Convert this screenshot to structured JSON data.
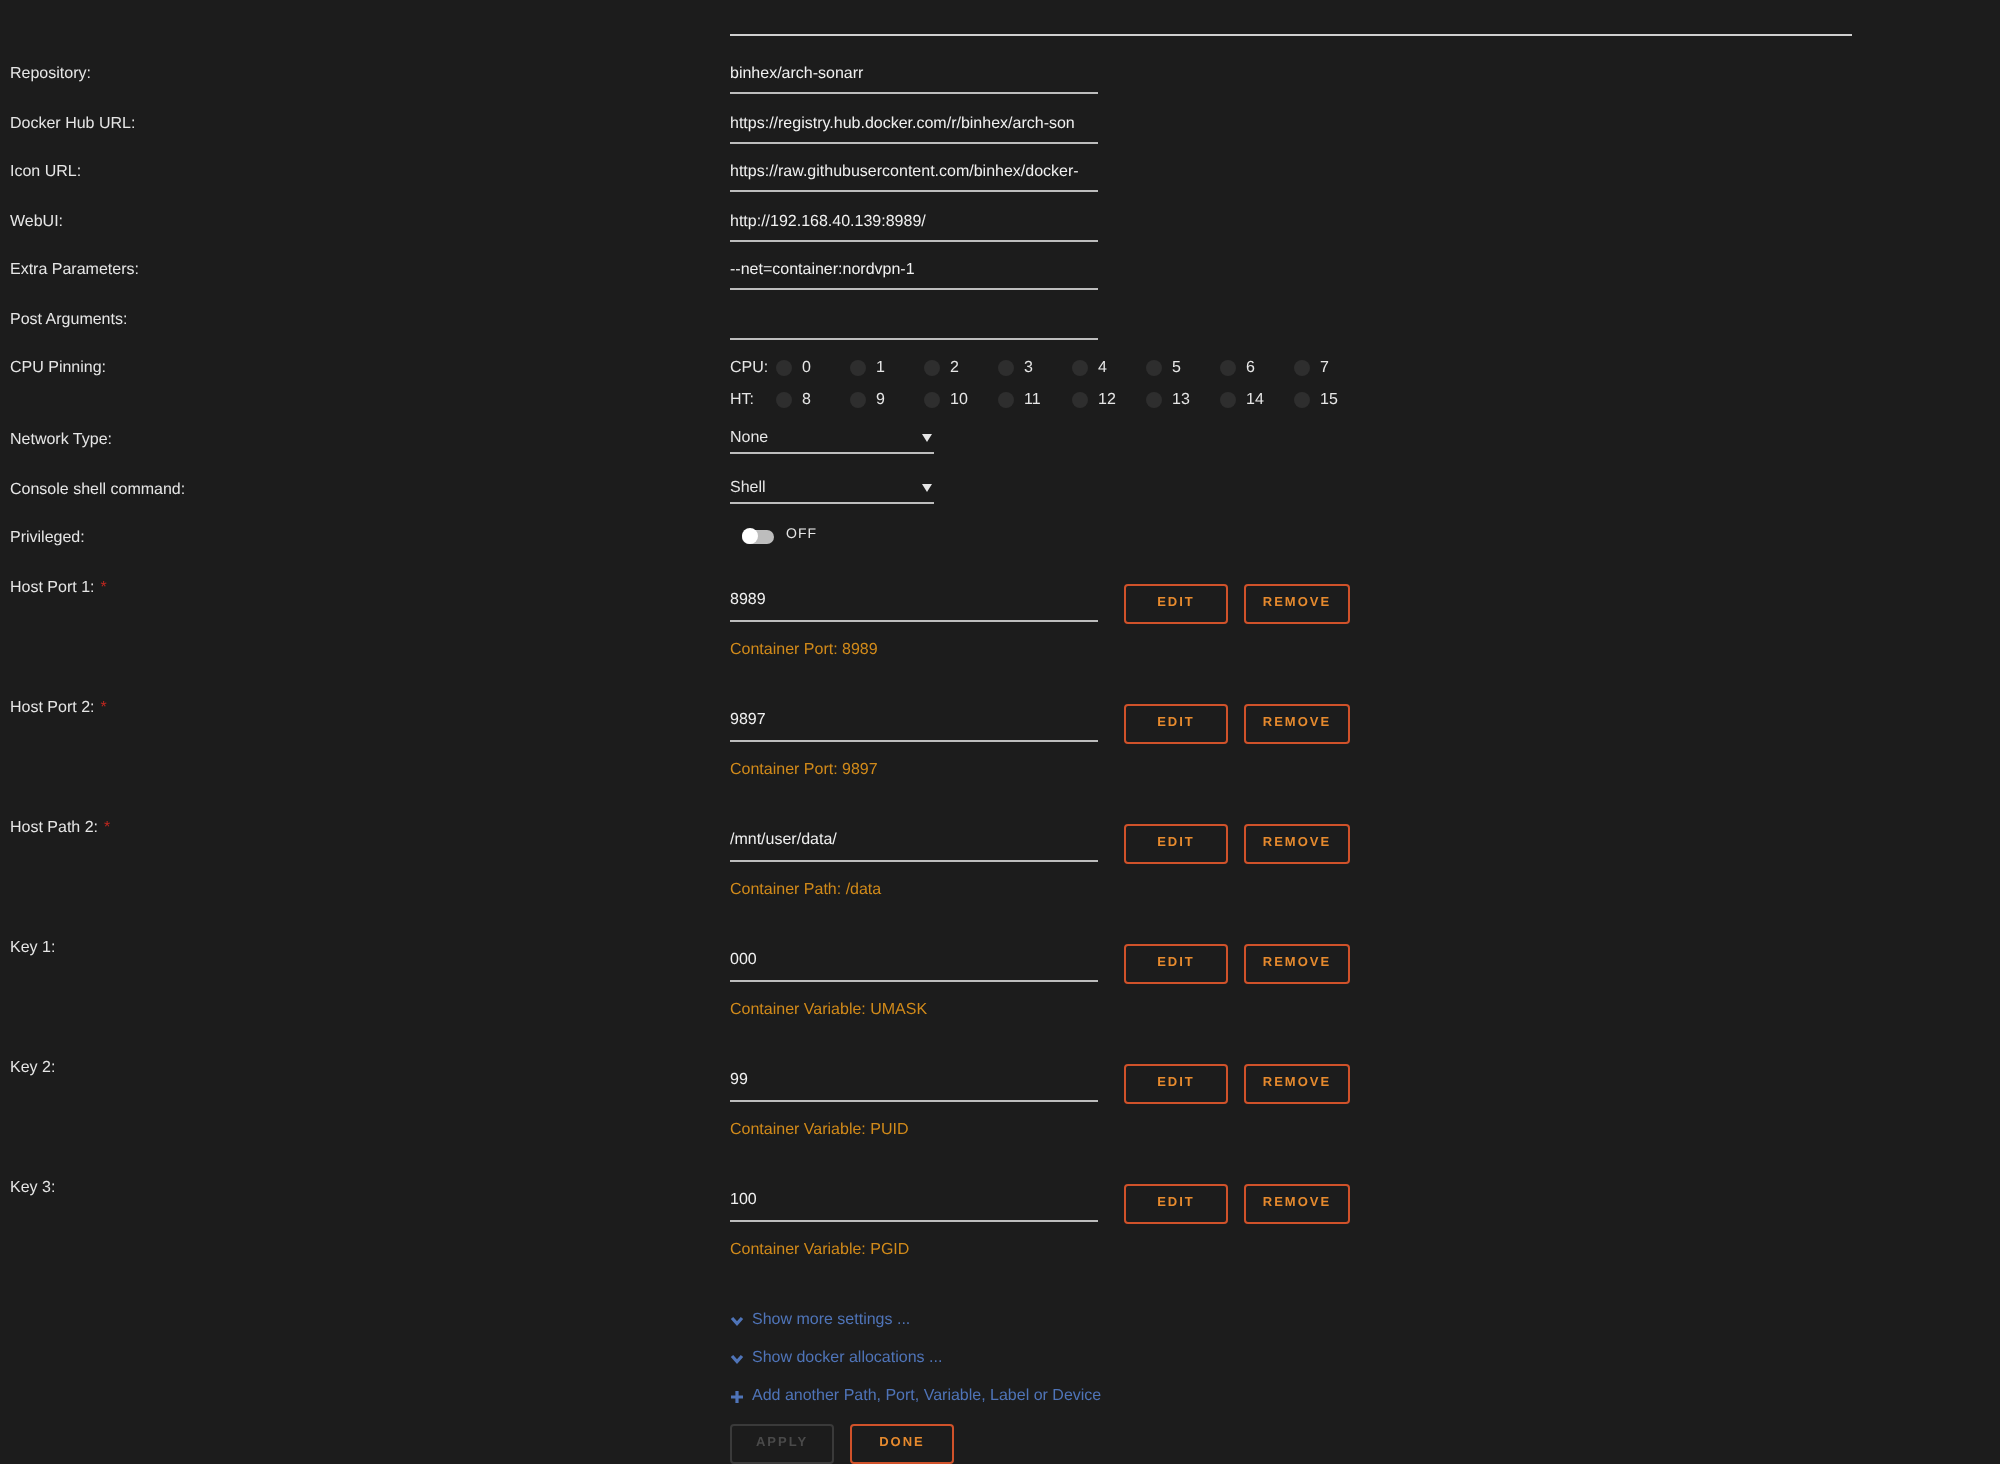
{
  "settings": [
    {
      "kind": "text",
      "label": "Repository:",
      "value": "binhex/arch-sonarr"
    },
    {
      "kind": "text",
      "label": "Docker Hub URL:",
      "value": "https://registry.hub.docker.com/r/binhex/arch-son"
    },
    {
      "kind": "text",
      "label": "Icon URL:",
      "value": "https://raw.githubusercontent.com/binhex/docker-"
    },
    {
      "kind": "text",
      "label": "WebUI:",
      "value": "http://192.168.40.139:8989/"
    },
    {
      "kind": "text",
      "label": "Extra Parameters:",
      "value": "--net=container:nordvpn-1"
    },
    {
      "kind": "text",
      "label": "Post Arguments:"
    },
    {
      "kind": "cpu",
      "label": "CPU Pinning:",
      "rows": [
        {
          "label": "CPU:",
          "cores": [
            {
              "label": "0",
              "checked": false
            },
            {
              "label": "1",
              "checked": false
            },
            {
              "label": "2",
              "checked": false
            },
            {
              "label": "3",
              "checked": false
            },
            {
              "label": "4",
              "checked": false
            },
            {
              "label": "5",
              "checked": false
            },
            {
              "label": "6",
              "checked": false
            },
            {
              "label": "7",
              "checked": false
            }
          ]
        },
        {
          "label": "HT:",
          "cores": [
            {
              "label": "8",
              "checked": false
            },
            {
              "label": "9",
              "checked": false
            },
            {
              "label": "10",
              "checked": false
            },
            {
              "label": "11",
              "checked": false
            },
            {
              "label": "12",
              "checked": false
            },
            {
              "label": "13",
              "checked": false
            },
            {
              "label": "14",
              "checked": false
            },
            {
              "label": "15",
              "checked": false
            }
          ]
        }
      ]
    },
    {
      "kind": "select",
      "label": "Network Type:",
      "value": "None"
    },
    {
      "kind": "select",
      "label": "Console shell command:",
      "value": "Shell"
    },
    {
      "kind": "toggle",
      "label": "Privileged:",
      "on": false,
      "state_text": "OFF"
    }
  ],
  "mappings": [
    {
      "label": "Host Port 1:",
      "required": true,
      "value": "8989",
      "description": "Container Port: 8989",
      "edit": "EDIT",
      "remove": "REMOVE"
    },
    {
      "label": "Host Port 2:",
      "required": true,
      "value": "9897",
      "description": "Container Port: 9897",
      "edit": "EDIT",
      "remove": "REMOVE"
    },
    {
      "label": "Host Path 2:",
      "required": true,
      "value": "/mnt/user/data/",
      "description": "Container Path: /data",
      "edit": "EDIT",
      "remove": "REMOVE"
    },
    {
      "label": "Key 1:",
      "required": false,
      "value": "000",
      "description": "Container Variable: UMASK",
      "edit": "EDIT",
      "remove": "REMOVE"
    },
    {
      "label": "Key 2:",
      "required": false,
      "value": "99",
      "description": "Container Variable: PUID",
      "edit": "EDIT",
      "remove": "REMOVE"
    },
    {
      "label": "Key 3:",
      "required": false,
      "value": "100",
      "description": "Container Variable: PGID",
      "edit": "EDIT",
      "remove": "REMOVE"
    }
  ],
  "required_mark": "*",
  "links": [
    {
      "kind": "expand",
      "label": "Show more settings ..."
    },
    {
      "kind": "expand",
      "label": "Show docker allocations ..."
    },
    {
      "kind": "add",
      "label": "Add another Path, Port, Variable, Label or Device"
    }
  ],
  "buttons": [
    {
      "label": "APPLY",
      "disabled": true
    },
    {
      "label": "DONE",
      "disabled": false
    }
  ]
}
